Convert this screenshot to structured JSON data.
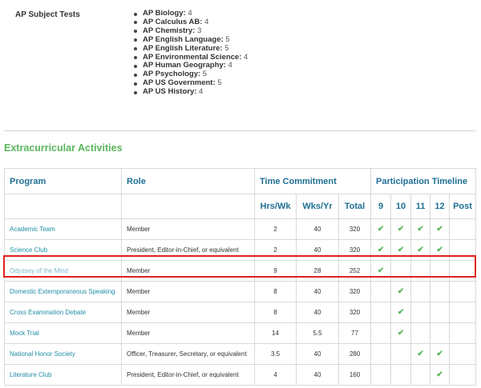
{
  "ap_section": {
    "label": "AP Subject Tests",
    "tests": [
      {
        "subject": "AP Biology:",
        "score": "4"
      },
      {
        "subject": "AP Calculus AB:",
        "score": "4"
      },
      {
        "subject": "AP Chemistry:",
        "score": "3"
      },
      {
        "subject": "AP English Language:",
        "score": "5"
      },
      {
        "subject": "AP English Literature:",
        "score": "5"
      },
      {
        "subject": "AP Environmental Science:",
        "score": "4"
      },
      {
        "subject": "AP Human Geography:",
        "score": "4"
      },
      {
        "subject": "AP Psychology:",
        "score": "5"
      },
      {
        "subject": "AP US Government:",
        "score": "5"
      },
      {
        "subject": "AP US History:",
        "score": "4"
      }
    ]
  },
  "extracurricular": {
    "title": "Extracurricular Activities",
    "headers": {
      "program": "Program",
      "role": "Role",
      "time_commitment": "Time Commitment",
      "participation_timeline": "Participation Timeline",
      "hrs_wk": "Hrs/Wk",
      "wks_yr": "Wks/Yr",
      "total": "Total",
      "grade_9": "9",
      "grade_10": "10",
      "grade_11": "11",
      "grade_12": "12",
      "post": "Post"
    },
    "check_glyph": "✔",
    "highlight_color": "#e02020",
    "accent_green": "#5bb55b",
    "link_color": "#1f8ea6",
    "rows": [
      {
        "program": "Academic Team",
        "role": "Member",
        "hrs": "2",
        "wks": "40",
        "total": "320",
        "g9": true,
        "g10": true,
        "g11": true,
        "g12": true,
        "post": false
      },
      {
        "program": "Science Club",
        "role": "President, Editor-in-Chief, or equivalent",
        "hrs": "2",
        "wks": "40",
        "total": "320",
        "g9": true,
        "g10": true,
        "g11": true,
        "g12": true,
        "post": false
      },
      {
        "program": "Odyssey of the Mind",
        "role": "Member",
        "hrs": "9",
        "wks": "28",
        "total": "252",
        "g9": true,
        "g10": false,
        "g11": false,
        "g12": false,
        "post": false,
        "highlighted": true
      },
      {
        "program": "Domestic Extemporaneous Speaking",
        "role": "Member",
        "hrs": "8",
        "wks": "40",
        "total": "320",
        "g9": false,
        "g10": true,
        "g11": false,
        "g12": false,
        "post": false
      },
      {
        "program": "Cross Examination Debate",
        "role": "Member",
        "hrs": "8",
        "wks": "40",
        "total": "320",
        "g9": false,
        "g10": true,
        "g11": false,
        "g12": false,
        "post": false
      },
      {
        "program": "Mock Trial",
        "role": "Member",
        "hrs": "14",
        "wks": "5.5",
        "total": "77",
        "g9": false,
        "g10": true,
        "g11": false,
        "g12": false,
        "post": false
      },
      {
        "program": "National Honor Society",
        "role": "Officer, Treasurer, Secretary, or equivalent",
        "hrs": "3.5",
        "wks": "40",
        "total": "280",
        "g9": false,
        "g10": false,
        "g11": true,
        "g12": true,
        "post": false
      },
      {
        "program": "Literature Club",
        "role": "President, Editor-in-Chief, or equivalent",
        "hrs": "4",
        "wks": "40",
        "total": "160",
        "g9": false,
        "g10": false,
        "g11": false,
        "g12": true,
        "post": false
      }
    ]
  }
}
